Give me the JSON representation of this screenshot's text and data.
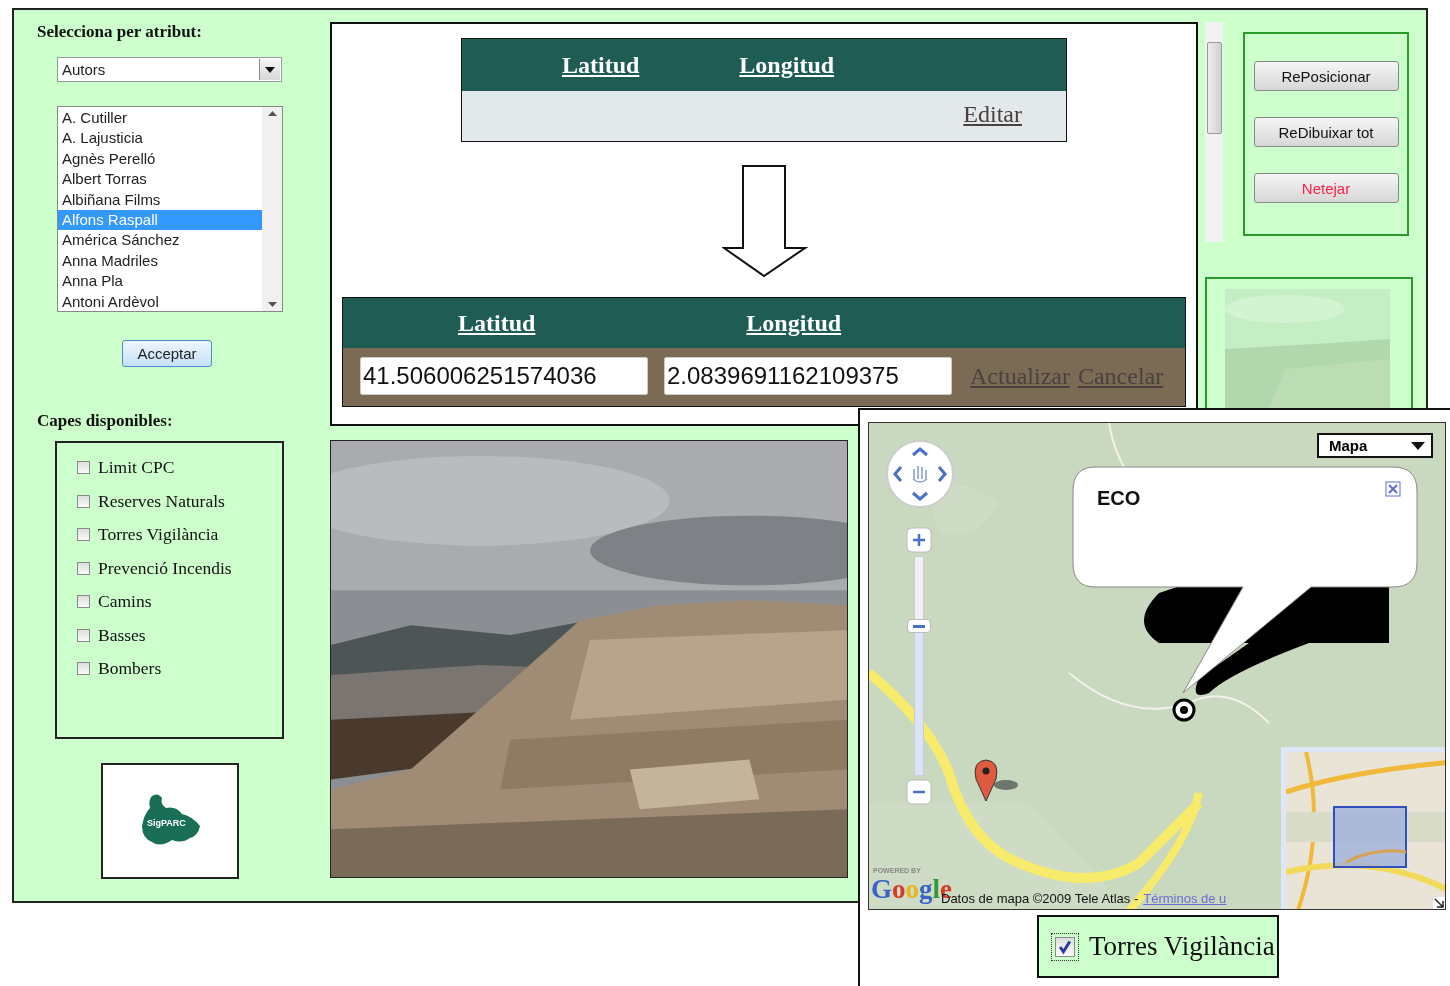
{
  "attribute_panel": {
    "title": "Selecciona per atribut:",
    "dropdown": {
      "value": "Autors"
    },
    "list": [
      {
        "label": "A. Cutiller",
        "selected": false
      },
      {
        "label": "A. Lajusticia",
        "selected": false
      },
      {
        "label": "Agnès Perelló",
        "selected": false
      },
      {
        "label": "Albert Torras",
        "selected": false
      },
      {
        "label": "Albiñana Films",
        "selected": false
      },
      {
        "label": "Alfons Raspall",
        "selected": true
      },
      {
        "label": "América Sánchez",
        "selected": false
      },
      {
        "label": "Anna Madriles",
        "selected": false
      },
      {
        "label": "Anna Pla",
        "selected": false
      },
      {
        "label": "Antoni Ardèvol",
        "selected": false
      }
    ],
    "accept_button": "Acceptar"
  },
  "layers_panel": {
    "title": "Capes disponibles:",
    "layers": [
      {
        "label": "Limit CPC",
        "checked": false
      },
      {
        "label": "Reserves Naturals",
        "checked": false
      },
      {
        "label": "Torres Vigilància",
        "checked": false
      },
      {
        "label": "Prevenció Incendis",
        "checked": false
      },
      {
        "label": "Camins",
        "checked": false
      },
      {
        "label": "Basses",
        "checked": false
      },
      {
        "label": "Bombers",
        "checked": false
      }
    ]
  },
  "logo": {
    "text": "SigPARC"
  },
  "actions": [
    {
      "label": "RePosicionar",
      "kind": "normal"
    },
    {
      "label": "ReDibuixar tot",
      "kind": "normal"
    },
    {
      "label": "Netejar",
      "kind": "danger"
    }
  ],
  "editor_demo": {
    "view_table": {
      "columns": [
        "Latitud",
        "Longitud"
      ],
      "edit_link": "Editar"
    },
    "edit_table": {
      "columns": [
        "Latitud",
        "Longitud"
      ],
      "latitude": "41.506006251574036",
      "longitude": "2.0839691162109375",
      "update_link": "Actualizar",
      "cancel_link": "Cancelar"
    }
  },
  "map": {
    "map_type": "Mapa",
    "zoom_slider": {
      "level": 0.68
    },
    "info_window": {
      "title": "ECO"
    },
    "powered_by": "POWERED BY",
    "logo": "Google",
    "attribution": "Datos de mapa ©2009 Tele Atlas -",
    "terms_link": "Términos de u"
  },
  "layer_toggle": {
    "label": "Torres Vigilància",
    "checked": true
  }
}
